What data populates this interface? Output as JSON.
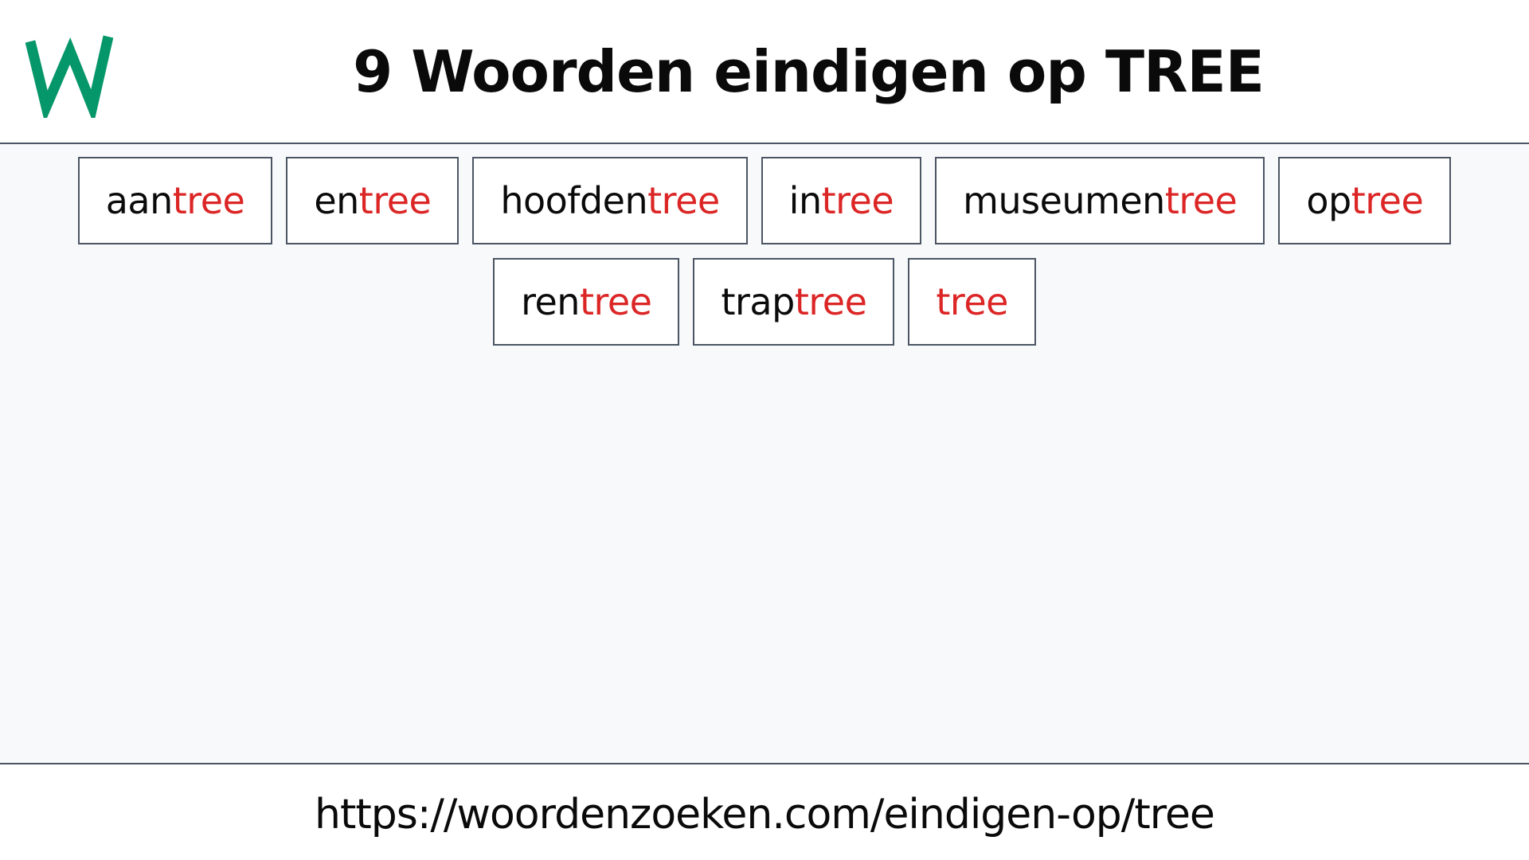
{
  "header": {
    "logo_letter": "W",
    "logo_color": "#059669",
    "title": "9 Woorden eindigen op TREE"
  },
  "colors": {
    "accent_suffix": "#dc2626",
    "border": "#4b5563",
    "main_background": "#f8f9fb"
  },
  "words": [
    {
      "prefix": "aan",
      "suffix": "tree"
    },
    {
      "prefix": "en",
      "suffix": "tree"
    },
    {
      "prefix": "hoofden",
      "suffix": "tree"
    },
    {
      "prefix": "in",
      "suffix": "tree"
    },
    {
      "prefix": "museumen",
      "suffix": "tree"
    },
    {
      "prefix": "op",
      "suffix": "tree"
    },
    {
      "prefix": "ren",
      "suffix": "tree"
    },
    {
      "prefix": "trap",
      "suffix": "tree"
    },
    {
      "prefix": "",
      "suffix": "tree"
    }
  ],
  "footer": {
    "url": "https://woordenzoeken.com/eindigen-op/tree"
  }
}
